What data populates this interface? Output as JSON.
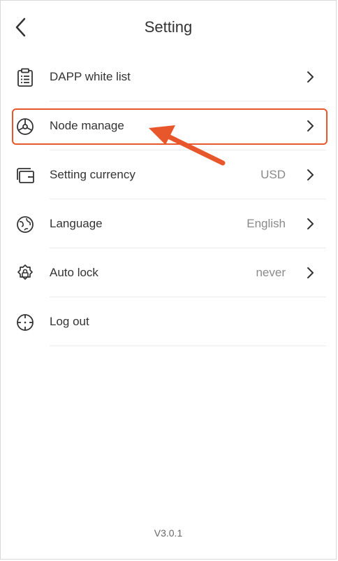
{
  "header": {
    "title": "Setting",
    "back_icon": "chevron-left-icon"
  },
  "menu": {
    "items": [
      {
        "label": "DAPP white list",
        "value": "",
        "icon": "clipboard-icon",
        "has_chevron": true
      },
      {
        "label": "Node manage",
        "value": "",
        "icon": "node-icon",
        "has_chevron": true,
        "highlighted": true
      },
      {
        "label": "Setting currency",
        "value": "USD",
        "icon": "wallet-icon",
        "has_chevron": true
      },
      {
        "label": "Language",
        "value": "English",
        "icon": "globe-icon",
        "has_chevron": true
      },
      {
        "label": "Auto lock",
        "value": "never",
        "icon": "gear-lock-icon",
        "has_chevron": true
      },
      {
        "label": "Log out",
        "value": "",
        "icon": "logout-icon",
        "has_chevron": false
      }
    ]
  },
  "footer": {
    "version": "V3.0.1"
  },
  "colors": {
    "highlight": "#e8572c",
    "text": "#333333",
    "muted": "#8a8a8a",
    "divider": "#ebebeb"
  }
}
